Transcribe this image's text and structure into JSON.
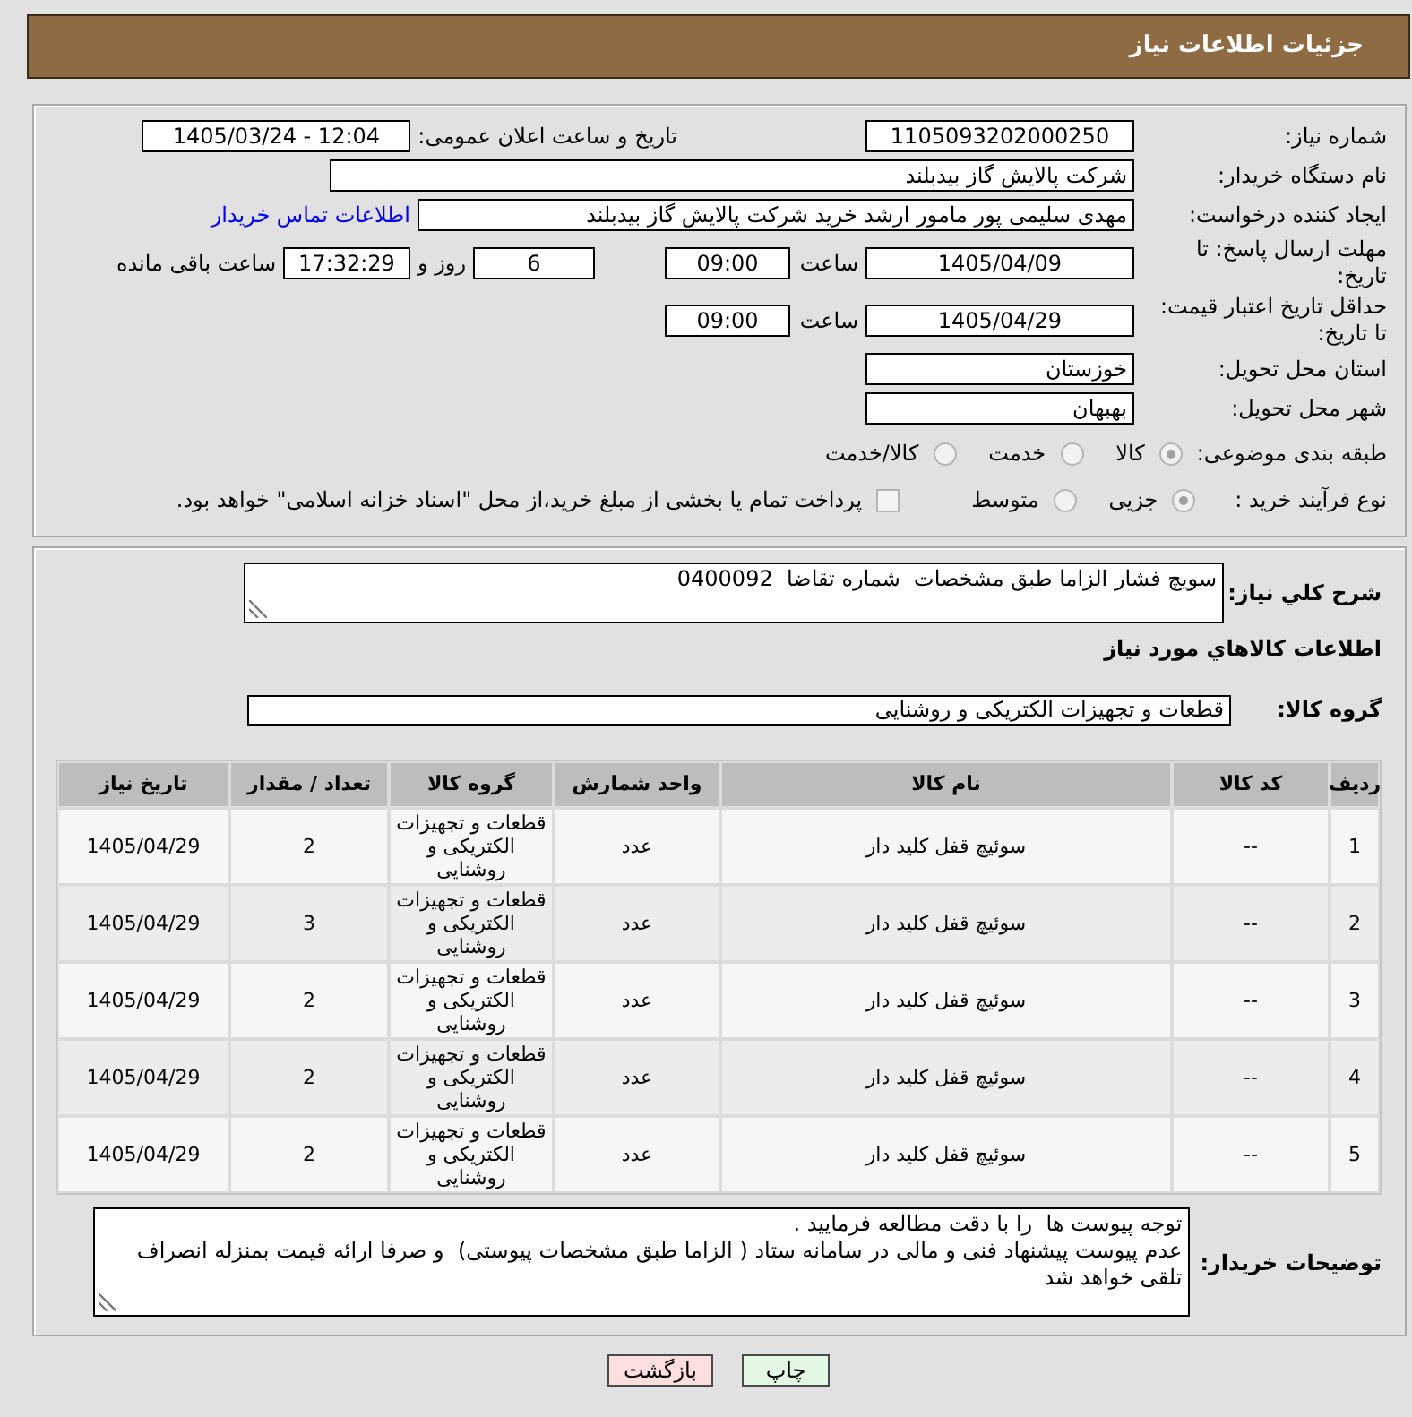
{
  "header": {
    "title": "جزئیات اطلاعات نیاز"
  },
  "details": {
    "need_number": {
      "label": "شماره نیاز:",
      "value": "1105093202000250"
    },
    "announcement": {
      "label": "تاریخ و ساعت اعلان عمومی:",
      "value": "1405/03/24 - 12:04"
    },
    "buyer_org": {
      "label": "نام دستگاه خریدار:",
      "value": "شرکت پالایش گاز بیدبلند"
    },
    "requester": {
      "label": "ایجاد کننده درخواست:",
      "value": "مهدی سلیمی پور مامور ارشد خرید شرکت پالایش گاز بیدبلند",
      "link": "اطلاعات تماس خریدار"
    },
    "response_deadline": {
      "label": "مهلت ارسال پاسخ: تا تاریخ:",
      "date": "1405/04/09",
      "time_label": "ساعت",
      "time": "09:00",
      "days": "6",
      "days_label": "روز و",
      "remaining": "17:32:29",
      "remaining_label": "ساعت باقی مانده"
    },
    "price_validity": {
      "label": "حداقل تاریخ اعتبار قیمت: تا تاریخ:",
      "date": "1405/04/29",
      "time_label": "ساعت",
      "time": "09:00"
    },
    "province": {
      "label": "استان محل تحویل:",
      "value": "خوزستان"
    },
    "city": {
      "label": "شهر محل تحویل:",
      "value": "بهبهان"
    },
    "category": {
      "label": "طبقه بندی موضوعی:",
      "options": [
        {
          "label": "کالا",
          "selected": true
        },
        {
          "label": "خدمت",
          "selected": false
        },
        {
          "label": "کالا/خدمت",
          "selected": false
        }
      ]
    },
    "process_type": {
      "label": "نوع فرآیند خرید :",
      "options": [
        {
          "label": "جزیی",
          "selected": true
        },
        {
          "label": "متوسط",
          "selected": false
        }
      ],
      "treasury": {
        "label": "پرداخت تمام یا بخشی از مبلغ خرید،از محل \"اسناد خزانه اسلامی\" خواهد بود.",
        "checked": false
      }
    }
  },
  "needs": {
    "description": {
      "label": "شرح کلي نياز:",
      "value": "سويچ فشار الزاما طبق مشخصات  شماره تقاضا  0400092"
    },
    "goods_title": "اطلاعات كالاهاي مورد نياز",
    "goods_group": {
      "label": "گروه كالا:",
      "value": "قطعات و تجهیزات الکتریکی و روشنایی"
    },
    "table": {
      "columns": [
        "ردیف",
        "کد کالا",
        "نام کالا",
        "واحد شمارش",
        "گروه کالا",
        "تعداد / مقدار",
        "تاریخ نیاز"
      ],
      "rows": [
        [
          "1",
          "--",
          "سوئیچ قفل کلید دار",
          "عدد",
          "قطعات و تجهیزات الکتریکی و روشنایی",
          "2",
          "1405/04/29"
        ],
        [
          "2",
          "--",
          "سوئیچ قفل کلید دار",
          "عدد",
          "قطعات و تجهیزات الکتریکی و روشنایی",
          "3",
          "1405/04/29"
        ],
        [
          "3",
          "--",
          "سوئیچ قفل کلید دار",
          "عدد",
          "قطعات و تجهیزات الکتریکی و روشنایی",
          "2",
          "1405/04/29"
        ],
        [
          "4",
          "--",
          "سوئیچ قفل کلید دار",
          "عدد",
          "قطعات و تجهیزات الکتریکی و روشنایی",
          "2",
          "1405/04/29"
        ],
        [
          "5",
          "--",
          "سوئیچ قفل کلید دار",
          "عدد",
          "قطعات و تجهیزات الکتریکی و روشنایی",
          "2",
          "1405/04/29"
        ]
      ]
    },
    "buyer_notes": {
      "label": "توضیحات خریدار:",
      "value": "توجه پیوست ها  را با دقت مطالعه فرمایید .\nعدم پیوست پیشنهاد فنی و مالی در سامانه ستاد ( الزاما طبق مشخصات پیوستی)  و صرفا ارائه قیمت بمنزله انصراف تلقی خواهد شد"
    }
  },
  "buttons": [
    {
      "label": "چاپ",
      "kind": "print"
    },
    {
      "label": "بازگشت",
      "kind": "back"
    }
  ]
}
